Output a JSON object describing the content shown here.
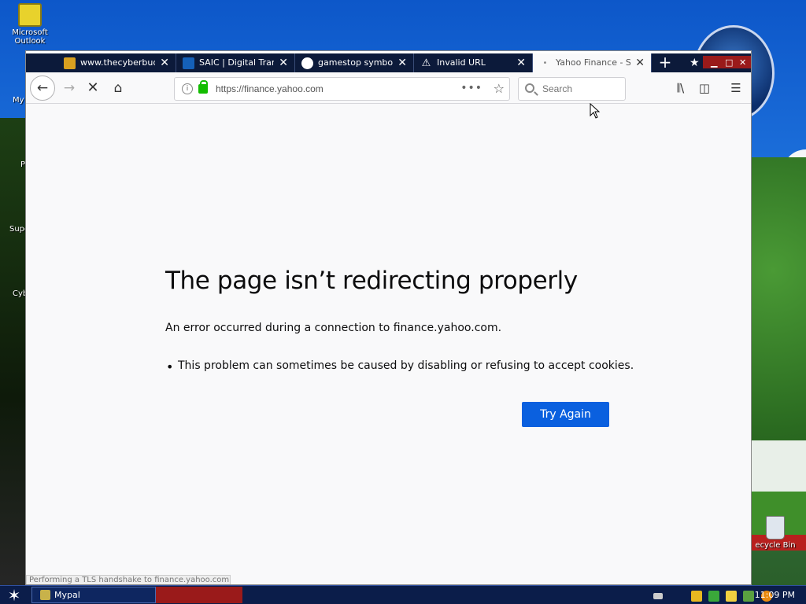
{
  "desktop": {
    "icons": [
      {
        "label_line1": "Microsoft",
        "label_line2": "Outlook"
      }
    ],
    "side_labels": [
      "My",
      "P",
      "Supe",
      "Cyb"
    ],
    "recycle_bin_label": "ecycle Bin"
  },
  "browser": {
    "tabs": [
      {
        "title": "www.thecyberbud",
        "favicon_color": "#d8a020"
      },
      {
        "title": "SAIC | Digital Trans",
        "favicon_color": "#1560b8"
      },
      {
        "title": "gamestop symbol -",
        "favicon_color": "#4285f4"
      },
      {
        "title": "Invalid URL",
        "favicon_color": "#ffffff"
      },
      {
        "title": "Yahoo Finance - St",
        "favicon_color": "#888888",
        "active": true
      }
    ],
    "new_tab_label": "+",
    "url": "https://finance.yahoo.com",
    "search_placeholder": "Search",
    "page_actions_label": "•••"
  },
  "error_page": {
    "title": "The page isn’t redirecting properly",
    "description": "An error occurred during a connection to finance.yahoo.com.",
    "bullets": [
      "This problem can sometimes be caused by disabling or refusing to accept cookies."
    ],
    "try_again_label": "Try Again",
    "status_text": "Performing a TLS handshake to finance.yahoo.com..."
  },
  "taskbar": {
    "task_label": "Mypal",
    "clock": "11:09 PM"
  }
}
